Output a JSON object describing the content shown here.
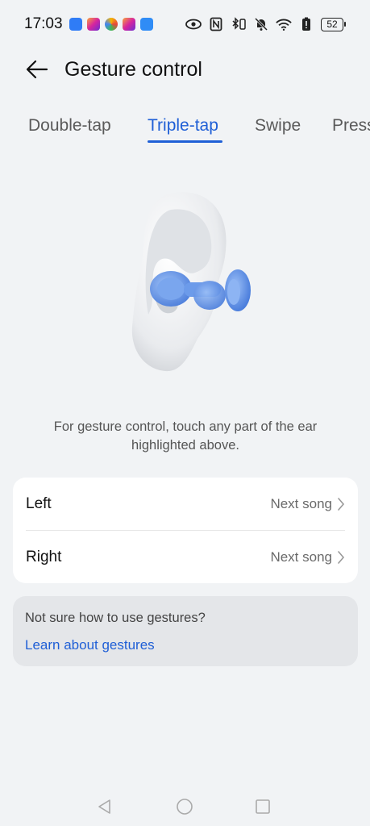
{
  "status_bar": {
    "time": "17:03",
    "battery": "52",
    "app_colors": [
      "#2f7cf6",
      "#d6249f",
      "#f5b400",
      "#d6249f",
      "#2f8cf6"
    ]
  },
  "header": {
    "title": "Gesture control"
  },
  "tabs": [
    {
      "label": "Double-tap"
    },
    {
      "label": "Triple-tap"
    },
    {
      "label": "Swipe"
    },
    {
      "label": "Press"
    }
  ],
  "active_tab": "Triple-tap",
  "description": "For gesture control, touch any part of the ear highlighted above.",
  "settings": [
    {
      "label": "Left",
      "value": "Next song"
    },
    {
      "label": "Right",
      "value": "Next song"
    }
  ],
  "help": {
    "text": "Not sure how to use gestures?",
    "link": "Learn about gestures"
  },
  "colors": {
    "accent": "#1f5fd6",
    "background": "#f1f3f5",
    "earbud": "#5b8ee6"
  }
}
